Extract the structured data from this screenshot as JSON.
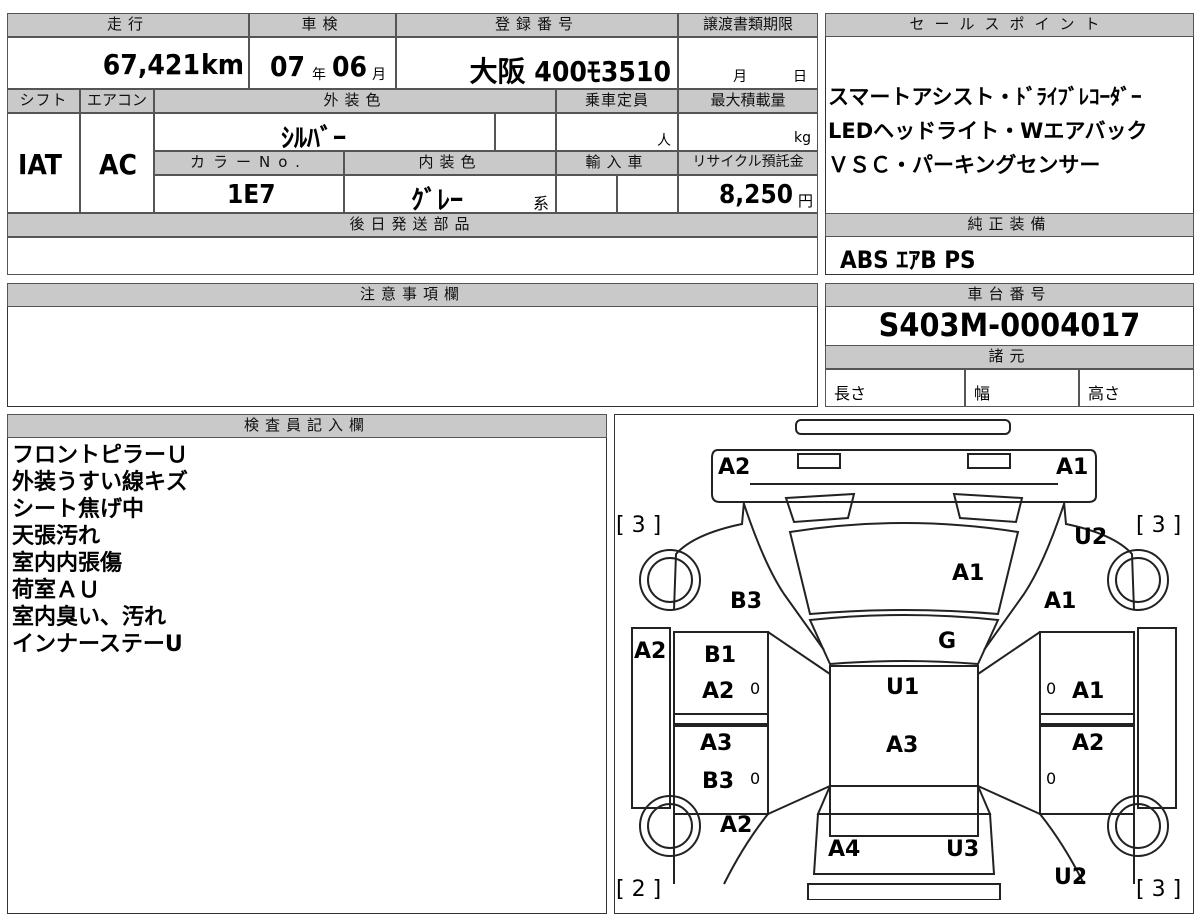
{
  "top_info": {
    "mileage_header": "走行",
    "mileage_value": "67,421",
    "mileage_unit": "km",
    "inspection_header": "車検",
    "inspection_year": "07",
    "inspection_year_unit": "年",
    "inspection_month": "06",
    "inspection_month_unit": "月",
    "registration_header": "登録番号",
    "registration_value": "大阪 400ﾓ3510",
    "transfer_header": "譲渡書類期限",
    "transfer_month_unit": "月",
    "transfer_day_unit": "日"
  },
  "row2": {
    "shift_header": "シフト",
    "shift_value": "IAT",
    "ac_header": "エアコン",
    "ac_value": "AC",
    "exterior_color_header": "外装色",
    "exterior_color_value": "ｼﾙﾊﾞｰ",
    "capacity_header": "乗車定員",
    "capacity_unit": "人",
    "max_load_header": "最大積載量",
    "max_load_unit": "kg",
    "color_no_header": "カラーNo.",
    "color_no_value": "1E7",
    "interior_color_header": "内装色",
    "interior_color_value": "ｸﾞﾚｰ",
    "interior_color_suffix": "系",
    "import_header": "輸入車",
    "recycle_header": "リサイクル預託金",
    "recycle_value": "8,250",
    "recycle_unit": "円"
  },
  "later_parts": {
    "header": "後日発送部品",
    "value": ""
  },
  "sales_points": {
    "header": "セールスポイント",
    "lines": [
      "スマートアシスト・ﾄﾞﾗｲﾌﾞﾚｺｰﾀﾞｰ",
      "LEDヘッドライト・Wエアバック",
      "ＶＳＣ・パーキングセンサー"
    ]
  },
  "genuine_equipment": {
    "header": "純正装備",
    "value": "ABS ｴｱB PS"
  },
  "notes": {
    "header": "注意事項欄",
    "value": ""
  },
  "chassis": {
    "header": "車台番号",
    "value": "S403M-0004017"
  },
  "specs": {
    "header": "諸元",
    "length": "長さ",
    "width": "幅",
    "height": "高さ"
  },
  "inspector": {
    "header": "検査員記入欄",
    "lines": [
      "フロントピラーＵ",
      "外装うすい線キズ",
      "シート焦げ中",
      "天張汚れ",
      "室内内張傷",
      "荷室ＡＵ",
      "室内臭い、汚れ",
      "インナーステーU"
    ]
  },
  "diagram": {
    "marks": [
      {
        "id": "front-left",
        "text": "A2"
      },
      {
        "id": "front-right",
        "text": "A1"
      },
      {
        "id": "bracket-top-left",
        "text": "[ 3 ]"
      },
      {
        "id": "bracket-top-right",
        "text": "[ 3 ]"
      },
      {
        "id": "bracket-bottom-left",
        "text": "[ 2 ]"
      },
      {
        "id": "bracket-bottom-right",
        "text": "[ 3 ]"
      },
      {
        "id": "right-front-fender",
        "text": "U2"
      },
      {
        "id": "hood",
        "text": "A1"
      },
      {
        "id": "left-front-fender",
        "text": "B3"
      },
      {
        "id": "right-front-fender-2",
        "text": "A1"
      },
      {
        "id": "windshield",
        "text": "G"
      },
      {
        "id": "left-pillar",
        "text": "A2"
      },
      {
        "id": "left-front-door-1",
        "text": "B1"
      },
      {
        "id": "left-front-door-2",
        "text": "A2"
      },
      {
        "id": "left-front-door-small",
        "text": "0"
      },
      {
        "id": "roof",
        "text": "U1"
      },
      {
        "id": "right-front-door-small",
        "text": "0"
      },
      {
        "id": "right-front-door",
        "text": "A1"
      },
      {
        "id": "left-rear-door-1",
        "text": "A3"
      },
      {
        "id": "left-rear-door-2",
        "text": "B3"
      },
      {
        "id": "left-rear-door-small",
        "text": "0"
      },
      {
        "id": "roof-rear",
        "text": "A3"
      },
      {
        "id": "right-rear-door",
        "text": "A2"
      },
      {
        "id": "right-rear-door-small",
        "text": "0"
      },
      {
        "id": "left-rear-fender",
        "text": "A2"
      },
      {
        "id": "rear-left",
        "text": "A4"
      },
      {
        "id": "rear-right",
        "text": "U3"
      },
      {
        "id": "right-rear-fender",
        "text": "U2"
      }
    ]
  }
}
